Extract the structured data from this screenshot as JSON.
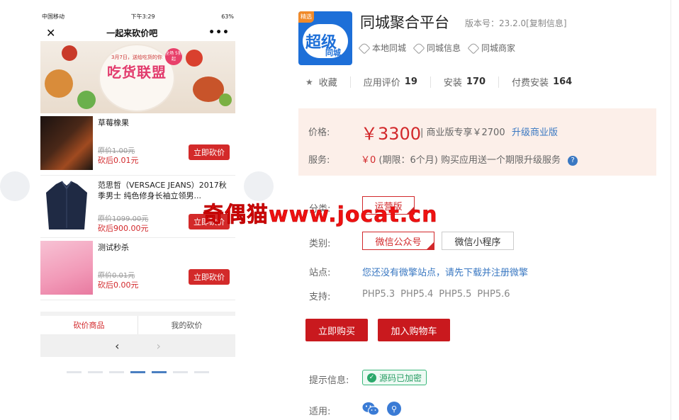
{
  "phone": {
    "status": {
      "carrier": "中国移动",
      "time": "下午3:29",
      "battery": "63%"
    },
    "title": "一起来砍价吧",
    "banner": {
      "headline": "吃货联盟",
      "small": "3月7日，送给吃货的你",
      "badge": "全场 5折起"
    },
    "cut_button_label": "立即砍价",
    "items": [
      {
        "title": "草莓橡果",
        "orig": "原价1.00元",
        "cut": "砍后0.01元"
      },
      {
        "title": "范思哲（VERSACE JEANS）2017秋季男士 纯色修身长袖立领男...",
        "orig": "原价1099.00元",
        "cut": "砍后900.00元"
      },
      {
        "title": "测试秒杀",
        "orig": "原价0.01元",
        "cut": "砍后0.00元"
      }
    ],
    "tabs": {
      "active": "砍价商品",
      "other": "我的砍价"
    },
    "pager": {
      "prev": "‹",
      "next": "›"
    }
  },
  "product": {
    "logo": {
      "corner": "精选",
      "line1": "超级",
      "line2": "同城"
    },
    "title": "同城聚合平台",
    "version": "版本号：23.2.0[复制信息]",
    "tags": [
      "本地同城",
      "同城信息",
      "同城商家"
    ],
    "favorite": "收藏",
    "stats": [
      {
        "label": "应用评价",
        "value": "19"
      },
      {
        "label": "安装",
        "value": "170"
      },
      {
        "label": "付费安装",
        "value": "164"
      }
    ],
    "price_label": "价格:",
    "price": "￥3300",
    "biz_price": "| 商业版专享￥2700",
    "upgrade": "升级商业版",
    "service_label": "服务:",
    "service_red": "￥0",
    "service_rest": "(期限：6个月)    购买应用送一个期限升级服务",
    "edition_label": "分类:",
    "edition_value": "运营版",
    "category_label": "类别:",
    "category_options": [
      "微信公众号",
      "微信小程序"
    ],
    "site_label": "站点:",
    "site_text": "您还没有微擎站点，请先下载并注册微擎",
    "support_label": "支持:",
    "php": [
      "PHP5.3",
      "PHP5.4",
      "PHP5.5",
      "PHP5.6"
    ],
    "buy_now": "立即购买",
    "add_cart": "加入购物车",
    "tip_label": "提示信息:",
    "encrypted": "源码已加密",
    "applicable_label": "适用:"
  },
  "watermark": "奇偶猫www.jocat.cn",
  "colors": {
    "accent_red": "#d2282b",
    "link_blue": "#3a78c2",
    "price_bg": "#fcefe9"
  }
}
